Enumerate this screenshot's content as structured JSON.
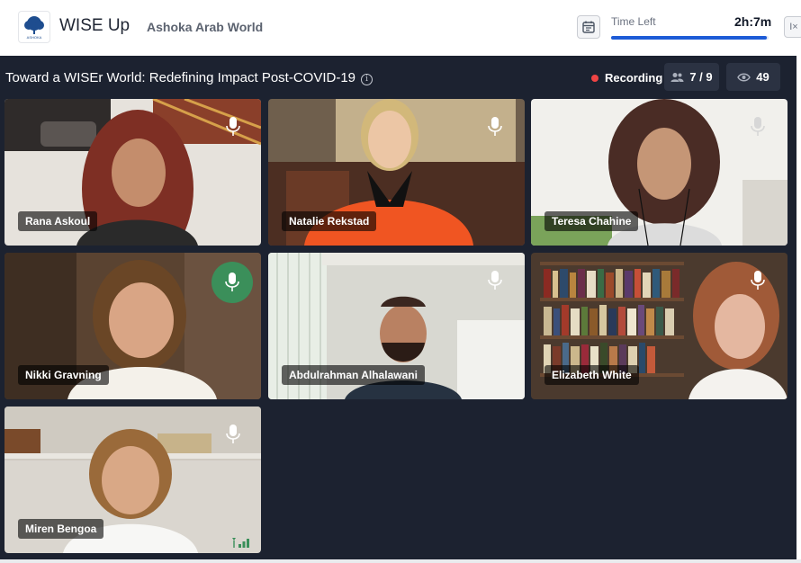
{
  "header": {
    "logo_icon": "ashoka-tree-logo",
    "logo_text": "ASHOKA",
    "app_title": "WISE Up",
    "org_name": "Ashoka Arab World",
    "calendar_icon": "calendar-icon",
    "time_left_label": "Time Left",
    "time_left_value": "2h:7m",
    "time_progress": 0.99,
    "collapse_icon": "expand-panel-icon",
    "collapse_glyph": "I×"
  },
  "session": {
    "title": "Toward a WISEr World: Redefining Impact Post-COVID-19",
    "info_icon": "info-icon",
    "recording_label": "Recording",
    "participants": "7 / 9",
    "participants_icon": "participants-icon",
    "viewers": "49",
    "viewers_icon": "eye-icon"
  },
  "participants": [
    {
      "name": "Rana Askoul",
      "mic_state": "idle",
      "bg": "#e6e2dc",
      "accent": "#7e2f24"
    },
    {
      "name": "Natalie Rekstad",
      "mic_state": "idle",
      "bg": "#6f5f4d",
      "accent": "#f05522"
    },
    {
      "name": "Teresa Chahine",
      "mic_state": "idle",
      "bg": "#f1f0ec",
      "accent": "#4a2c25"
    },
    {
      "name": "Nikki Gravning",
      "mic_state": "speaking",
      "bg": "#5a4331",
      "accent": "#f4f1ea"
    },
    {
      "name": "Abdulrahman Alhalawani",
      "mic_state": "idle",
      "bg": "#d8d8d1",
      "accent": "#263241"
    },
    {
      "name": "Elizabeth White",
      "mic_state": "idle",
      "bg": "#4b3a2e",
      "accent": "#a05a38"
    },
    {
      "name": "Miren Bengoa",
      "mic_state": "idle",
      "bg": "#dad6cf",
      "accent": "#f7f7f5"
    }
  ],
  "colors": {
    "stage_bg": "#1c2230",
    "accent_blue": "#1d5bd6",
    "speaking_green": "#3b8f5a",
    "recording_red": "#ef4444"
  }
}
